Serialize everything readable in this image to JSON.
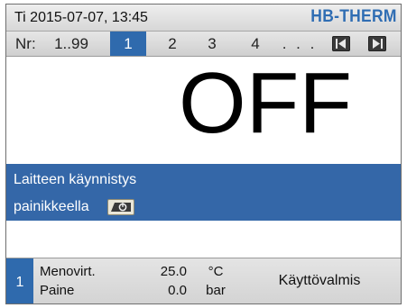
{
  "header": {
    "datetime": "Ti 2015-07-07, 13:45",
    "brand": "HB-THERM"
  },
  "nav": {
    "label": "Nr:",
    "range": "1..99",
    "units": [
      "1",
      "2",
      "3",
      "4"
    ],
    "selected_unit": "1",
    "ellipsis": ". . .",
    "prev_icon": "skip-back-icon",
    "next_icon": "skip-forward-icon"
  },
  "main": {
    "state": "OFF",
    "message_line1": "Laitteen käynnistys",
    "message_line2": "painikkeella",
    "message_icon": "power-key-icon"
  },
  "footer": {
    "unit": "1",
    "rows": [
      {
        "label": "Menovirt.",
        "value": "25.0",
        "unit": "°C"
      },
      {
        "label": "Paine",
        "value": "0.0",
        "unit": "bar"
      }
    ],
    "status": "Käyttövalmis"
  },
  "colors": {
    "accent_blue": "#2f6aad",
    "banner_blue": "#3467a8",
    "brand_blue": "#2f6db3"
  }
}
